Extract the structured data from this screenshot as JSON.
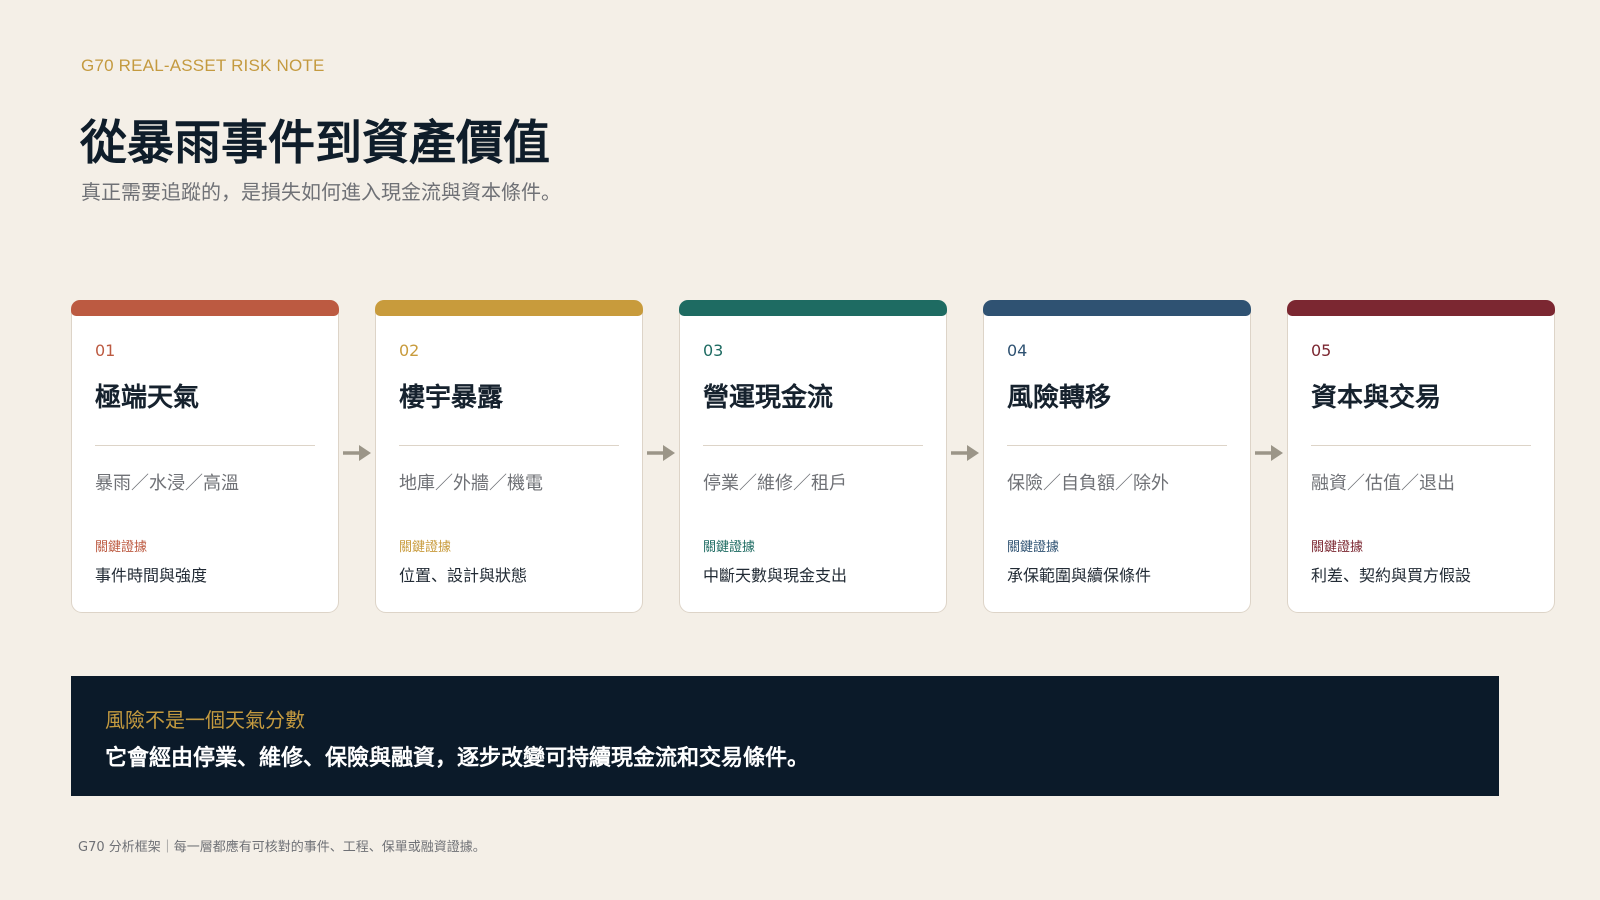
{
  "header": {
    "eyebrow": "G70 REAL-ASSET RISK NOTE",
    "title": "從暴雨事件到資產價值",
    "subtitle": "真正需要追蹤的，是損失如何進入現金流與資本條件。"
  },
  "cards": [
    {
      "num": "01",
      "title": "極端天氣",
      "items": "暴雨／水浸／高溫",
      "key_label": "關鍵證據",
      "key_value": "事件時間與強度",
      "color": "#bc5a41"
    },
    {
      "num": "02",
      "title": "樓宇暴露",
      "items": "地庫／外牆／機電",
      "key_label": "關鍵證據",
      "key_value": "位置、設計與狀態",
      "color": "#c89b3c"
    },
    {
      "num": "03",
      "title": "營運現金流",
      "items": "停業／維修／租戶",
      "key_label": "關鍵證據",
      "key_value": "中斷天數與現金支出",
      "color": "#1e6b62"
    },
    {
      "num": "04",
      "title": "風險轉移",
      "items": "保險／自負額／除外",
      "key_label": "關鍵證據",
      "key_value": "承保範圍與續保條件",
      "color": "#2f5272"
    },
    {
      "num": "05",
      "title": "資本與交易",
      "items": "融資／估值／退出",
      "key_label": "關鍵證據",
      "key_value": "利差、契約與買方假設",
      "color": "#7b2731"
    }
  ],
  "arrow_color": "#9b9588",
  "banner": {
    "kicker": "風險不是一個天氣分數",
    "text": "它會經由停業、維修、保險與融資，逐步改變可持續現金流和交易條件。"
  },
  "footer": {
    "text": "G70 分析框架｜每一層都應有可核對的事件、工程、保單或融資證據。"
  }
}
